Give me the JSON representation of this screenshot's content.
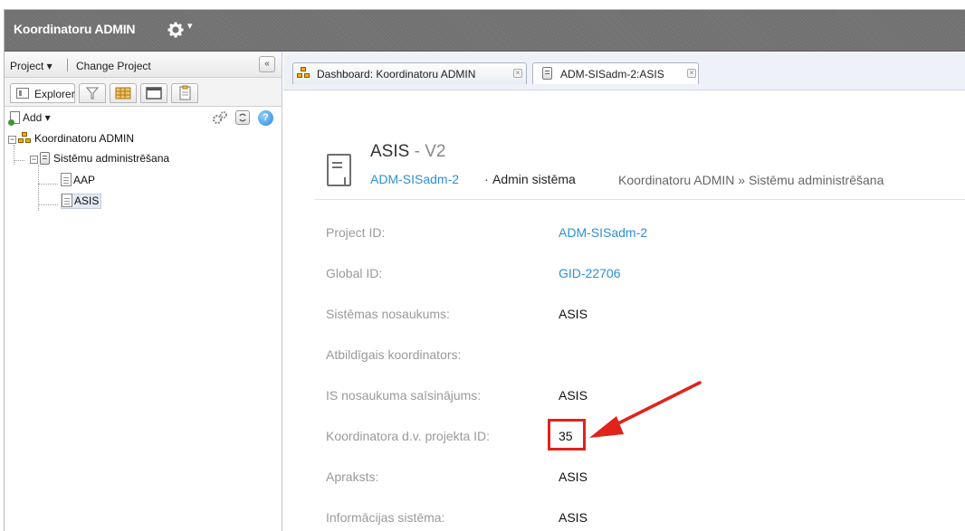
{
  "app": {
    "title": "Koordinatoru ADMIN",
    "gear_caret": "▾"
  },
  "left_panel": {
    "project_menu": "Project ▾",
    "change_project": "Change Project",
    "collapse": "«",
    "tabs": {
      "explorer": "Explorer"
    },
    "add_label": "Add ▾",
    "help": "?",
    "tree": [
      {
        "label": "Koordinatoru ADMIN",
        "toggle": "−"
      },
      {
        "label": "Sistēmu administrēšana",
        "toggle": "−"
      },
      {
        "label": "AAP"
      },
      {
        "label": "ASIS"
      }
    ]
  },
  "tabs": [
    {
      "label": "Dashboard: Koordinatoru ADMIN",
      "close": "×"
    },
    {
      "label": "ADM-SISadm-2:ASIS",
      "close": "×"
    }
  ],
  "header": {
    "name": "ASIS",
    "dash": " - ",
    "version": "V2",
    "id": "ADM-SISadm-2",
    "dot": "·",
    "type": "Admin sistēma",
    "path": "Koordinatoru ADMIN » Sistēmu administrēšana"
  },
  "fields": [
    {
      "label": "Project ID:",
      "value": "ADM-SISadm-2"
    },
    {
      "label": "Global ID:",
      "value": "GID-22706"
    },
    {
      "label": "Sistēmas nosaukums:",
      "value": "ASIS"
    },
    {
      "label": "Atbildīgais koordinators:",
      "value": ""
    },
    {
      "label": "IS nosaukuma saīsinājums:",
      "value": "ASIS"
    },
    {
      "label": "Koordinatora d.v. projekta ID:",
      "value": "35"
    },
    {
      "label": "Apraksts:",
      "value": "ASIS"
    },
    {
      "label": "Informācijas sistēma:",
      "value": "ASIS"
    }
  ],
  "colors": {
    "link": "#2e8fd6",
    "annotation": "#e0231b",
    "titlebar": "#727272"
  }
}
